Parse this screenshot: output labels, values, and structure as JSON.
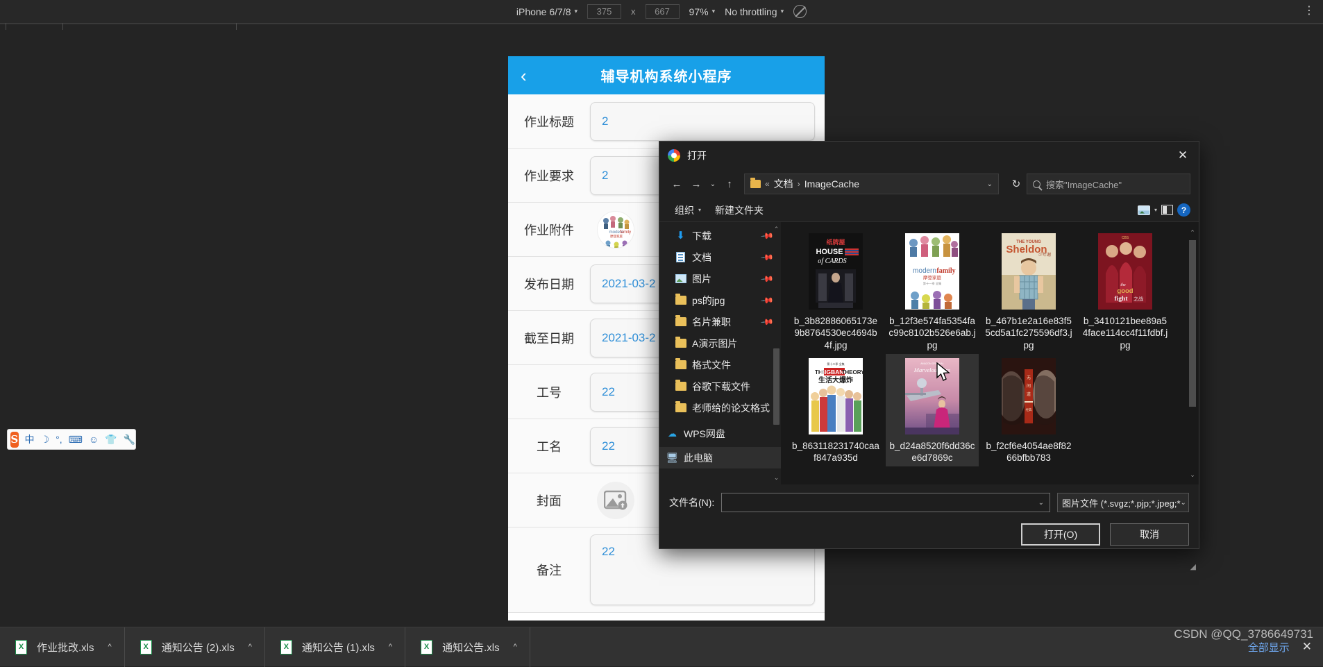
{
  "devtools": {
    "device": "iPhone 6/7/8",
    "width": "375",
    "height": "667",
    "x_separator": "x",
    "zoom": "97%",
    "throttling": "No throttling",
    "caret": "▾",
    "kebab": "⋮",
    "no_throttling_icon": "no-network-icon"
  },
  "phone": {
    "back_icon": "‹",
    "title": "辅导机构系统小程序",
    "rows": [
      {
        "label": "作业标题",
        "value": "2",
        "type": "text"
      },
      {
        "label": "作业要求",
        "value": "2",
        "type": "text"
      },
      {
        "label": "作业附件",
        "value": "",
        "type": "image"
      },
      {
        "label": "发布日期",
        "value": "2021-03-2",
        "type": "text"
      },
      {
        "label": "截至日期",
        "value": "2021-03-2",
        "type": "text"
      },
      {
        "label": "工号",
        "value": "22",
        "type": "text"
      },
      {
        "label": "工名",
        "value": "22",
        "type": "text"
      },
      {
        "label": "封面",
        "value": "",
        "type": "upload"
      },
      {
        "label": "备注",
        "value": "22",
        "type": "textarea"
      }
    ]
  },
  "dialog": {
    "title": "打开",
    "close_icon": "✕",
    "nav": {
      "back": "←",
      "forward": "→",
      "history": "⌄",
      "up": "↑"
    },
    "address": {
      "prefix": "«",
      "crumbs": [
        "文档",
        "ImageCache"
      ],
      "separator": "›",
      "caret": "⌄"
    },
    "refresh_icon": "↻",
    "search": {
      "placeholder": "搜索\"ImageCache\"",
      "icon": "search-icon"
    },
    "commands": {
      "organize": "组织",
      "organize_caret": "▾",
      "new_folder": "新建文件夹",
      "view_caret": "▾",
      "help": "?"
    },
    "sidebar": [
      {
        "label": "下载",
        "icon": "download-icon",
        "pinned": true
      },
      {
        "label": "文档",
        "icon": "document-icon",
        "pinned": true
      },
      {
        "label": "图片",
        "icon": "pictures-icon",
        "pinned": true
      },
      {
        "label": "ps的jpg",
        "icon": "folder-icon",
        "pinned": true
      },
      {
        "label": "名片兼职",
        "icon": "folder-icon",
        "pinned": true
      },
      {
        "label": "A演示图片",
        "icon": "folder-icon",
        "pinned": false
      },
      {
        "label": "格式文件",
        "icon": "folder-icon",
        "pinned": false
      },
      {
        "label": "谷歌下载文件",
        "icon": "folder-icon",
        "pinned": false
      },
      {
        "label": "老师给的论文格式",
        "icon": "folder-icon",
        "pinned": false
      },
      {
        "label": "WPS网盘",
        "icon": "cloud-icon",
        "pinned": false,
        "root": true
      },
      {
        "label": "此电脑",
        "icon": "computer-icon",
        "pinned": false,
        "root": true,
        "selected": true
      }
    ],
    "scroll": {
      "up": "⌃",
      "down": "⌄"
    },
    "files": [
      {
        "name": "b_3b82886065173e9b8764530ec4694b4f.jpg",
        "poster": "house-of-cards",
        "selected": false
      },
      {
        "name": "b_12f3e574fa5354fac99c8102b526e6ab.jpg",
        "poster": "modern-family",
        "selected": false
      },
      {
        "name": "b_467b1e2a16e83f55cd5a1fc275596df3.jpg",
        "poster": "young-sheldon",
        "selected": false
      },
      {
        "name": "b_3410121bee89a54face114cc4f11fdbf.jpg",
        "poster": "the-good-fight",
        "selected": false
      },
      {
        "name": "b_863118231740caaf847a935d",
        "poster": "big-bang-theory",
        "selected": false
      },
      {
        "name": "b_d24a8520f6dd36ce6d7869c",
        "poster": "marvelous-mrs-maisel",
        "selected": true
      },
      {
        "name": "b_f2cf6e4054ae8f8266bfbb783",
        "poster": "dark-portrait",
        "selected": false
      }
    ],
    "filename": {
      "label": "文件名(N):",
      "value": "",
      "caret": "⌄"
    },
    "filter": {
      "value": "图片文件 (*.svgz;*.pjp;*.jpeg;*",
      "caret": "⌄"
    },
    "buttons": {
      "open": "打开(O)",
      "cancel": "取消"
    },
    "resize_grip": "◢"
  },
  "ime": {
    "logo": "S",
    "items": [
      "中",
      "☽",
      "°,",
      "⌨",
      "☺",
      "👕",
      "🔧"
    ]
  },
  "downloads": {
    "items": [
      {
        "name": "作业批改.xls",
        "caret": "^"
      },
      {
        "name": "通知公告 (2).xls",
        "caret": "^"
      },
      {
        "name": "通知公告 (1).xls",
        "caret": "^"
      },
      {
        "name": "通知公告.xls",
        "caret": "^"
      }
    ],
    "show_all": "全部显示",
    "close": "✕"
  },
  "watermark": "CSDN @QQ_3786649731",
  "colors": {
    "accent_blue": "#18a0e8",
    "dialog_bg": "#202020",
    "file_pane_bg": "#191919",
    "selection": "#333333",
    "link_blue": "#6fa8f0",
    "field_text_blue": "#2f8fd8"
  }
}
